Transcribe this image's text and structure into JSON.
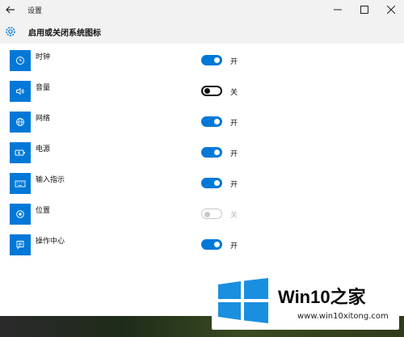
{
  "window": {
    "title": "设置"
  },
  "header": {
    "title": "启用或关闭系统图标"
  },
  "items": [
    {
      "label": "时钟",
      "state": "开"
    },
    {
      "label": "音量",
      "state": "关"
    },
    {
      "label": "网络",
      "state": "开"
    },
    {
      "label": "电源",
      "state": "开"
    },
    {
      "label": "输入指示",
      "state": "开"
    },
    {
      "label": "位置",
      "state": "关"
    },
    {
      "label": "操作中心",
      "state": "开"
    }
  ],
  "toggles": [
    "on",
    "off",
    "on",
    "on",
    "on",
    "disabled",
    "on"
  ],
  "icons": [
    "clock-icon",
    "volume-icon",
    "network-icon",
    "power-icon",
    "keyboard-icon",
    "location-icon",
    "action-center-icon"
  ],
  "watermark": {
    "brand": "Win10之家",
    "url": "www.win10xitong.com"
  },
  "colors": {
    "accent": "#0078d7",
    "titlebar": "#f2f2f2"
  }
}
